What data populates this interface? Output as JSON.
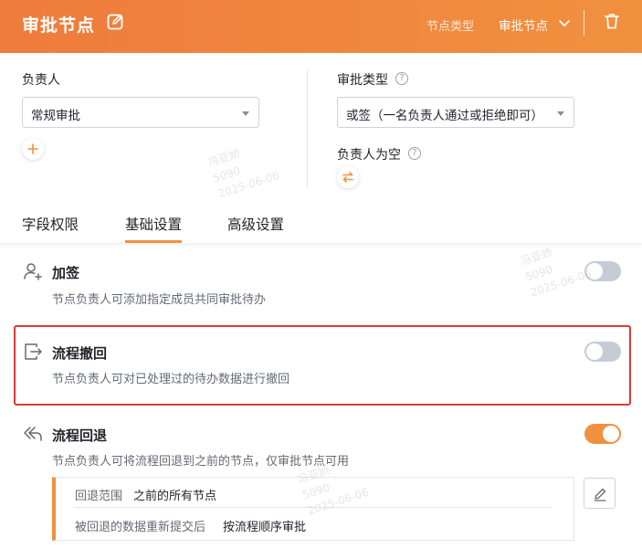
{
  "header": {
    "title": "审批节点",
    "node_type_label": "节点类型",
    "node_type_value": "审批节点",
    "background_color": "#ef7b3c"
  },
  "assignee": {
    "label": "负责人",
    "select_value": "常规审批",
    "add_icon": "plus-icon"
  },
  "approval_type": {
    "label": "审批类型",
    "help_icon": "question-icon",
    "select_value": "或签（一名负责人通过或拒绝即可）"
  },
  "empty_assignee": {
    "label": "负责人为空",
    "help_icon": "question-icon",
    "action_icon": "swap-icon"
  },
  "tabs": [
    {
      "label": "字段权限",
      "active": false
    },
    {
      "label": "基础设置",
      "active": true
    },
    {
      "label": "高级设置",
      "active": false
    }
  ],
  "settings": [
    {
      "icon": "add-user-icon",
      "title": "加签",
      "description": "节点负责人可添加指定成员共同审批待办",
      "enabled": false
    },
    {
      "icon": "withdraw-icon",
      "title": "流程撤回",
      "description": "节点负责人可对已处理过的待办数据进行撤回",
      "enabled": false,
      "highlighted": true
    },
    {
      "icon": "rollback-icon",
      "title": "流程回退",
      "description": "节点负责人可将流程回退到之前的节点，仅审批节点可用",
      "enabled": true
    }
  ],
  "rollback_detail": {
    "scope_label": "回退范围",
    "scope_value": "之前的所有节点",
    "resubmit_label": "被回退的数据重新提交后",
    "resubmit_value": "按流程顺序审批"
  },
  "watermark": {
    "name": "冯亚娇",
    "id": "5090",
    "date": "2025-06-06"
  },
  "colors": {
    "accent": "#f0913f",
    "highlight_border": "#d93a3a",
    "toggle_off": "#c6ccd6"
  }
}
